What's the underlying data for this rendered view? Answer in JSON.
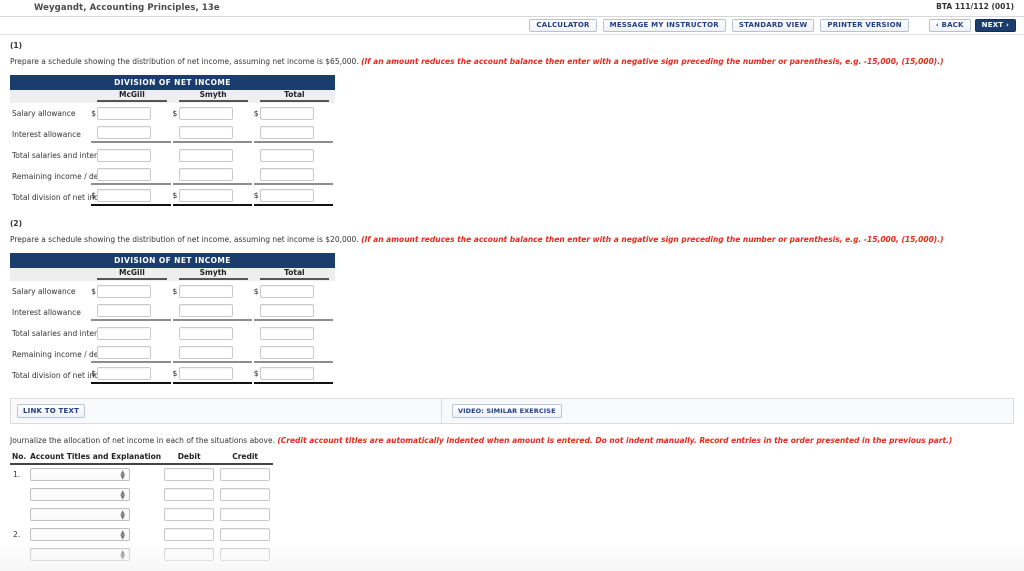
{
  "header": {
    "logo_icon": "wiley-logo",
    "title": "Weygandt, Accounting Principles, 13e",
    "course_code": "BTA 111/112 (001)"
  },
  "toolbar": {
    "calculator": "CALCULATOR",
    "message_instructor": "MESSAGE MY INSTRUCTOR",
    "standard_view": "STANDARD VIEW",
    "printer_version": "PRINTER VERSION",
    "back": "‹ BACK",
    "next": "NEXT ›"
  },
  "parts": [
    {
      "number": "(1)",
      "prompt": "Prepare a schedule showing the distribution of net income, assuming net income is $65,000. ",
      "hint": "(If an amount reduces the account balance then enter with a negative sign preceding the number or parenthesis, e.g. -15,000, (15,000).)",
      "table": {
        "title": "DIVISION OF NET INCOME",
        "columns": [
          "McGill",
          "Smyth",
          "Total"
        ],
        "rows": [
          {
            "label": "Salary allowance",
            "dollar": true,
            "underline": "none"
          },
          {
            "label": "Interest allowance",
            "dollar": false,
            "underline": "gray"
          },
          {
            "label": "Total salaries and interest",
            "dollar": false,
            "underline": "none"
          },
          {
            "label": "Remaining income / deficiency",
            "dollar": false,
            "underline": "gray"
          },
          {
            "label": "Total division of net income",
            "dollar": true,
            "underline": "black"
          }
        ]
      }
    },
    {
      "number": "(2)",
      "prompt": "Prepare a schedule showing the distribution of net income, assuming net income is $20,000. ",
      "hint": "(If an amount reduces the account balance then enter with a negative sign preceding the number or parenthesis, e.g. -15,000, (15,000).)",
      "table": {
        "title": "DIVISION OF NET INCOME",
        "columns": [
          "McGill",
          "Smyth",
          "Total"
        ],
        "rows": [
          {
            "label": "Salary allowance",
            "dollar": true,
            "underline": "none"
          },
          {
            "label": "Interest allowance",
            "dollar": false,
            "underline": "gray"
          },
          {
            "label": "Total salaries and interest",
            "dollar": false,
            "underline": "none"
          },
          {
            "label": "Remaining income / deficiency",
            "dollar": false,
            "underline": "gray"
          },
          {
            "label": "Total division of net income",
            "dollar": true,
            "underline": "black"
          }
        ]
      }
    }
  ],
  "linkbar": {
    "link_to_text": "LINK TO TEXT",
    "video": "VIDEO: SIMILAR EXERCISE"
  },
  "journal": {
    "prompt": "Journalize the allocation of net income in each of the situations above. ",
    "hint": "(Credit account titles are automatically indented when amount is entered. Do not indent manually. Record entries in the order presented in the previous part.)",
    "columns": {
      "no": "No.",
      "account": "Account Titles and Explanation",
      "debit": "Debit",
      "credit": "Credit"
    },
    "rows": [
      {
        "no": "1.",
        "account": "",
        "debit": "",
        "credit": ""
      },
      {
        "no": "",
        "account": "",
        "debit": "",
        "credit": ""
      },
      {
        "no": "",
        "account": "",
        "debit": "",
        "credit": ""
      },
      {
        "no": "2.",
        "account": "",
        "debit": "",
        "credit": ""
      },
      {
        "no": "",
        "account": "",
        "debit": "",
        "credit": ""
      }
    ]
  },
  "colors": {
    "table_header_bg": "#1b3d6d",
    "hint_red": "#e8291c",
    "button_text": "#1f3f80",
    "next_bg": "#1b3d6d"
  }
}
